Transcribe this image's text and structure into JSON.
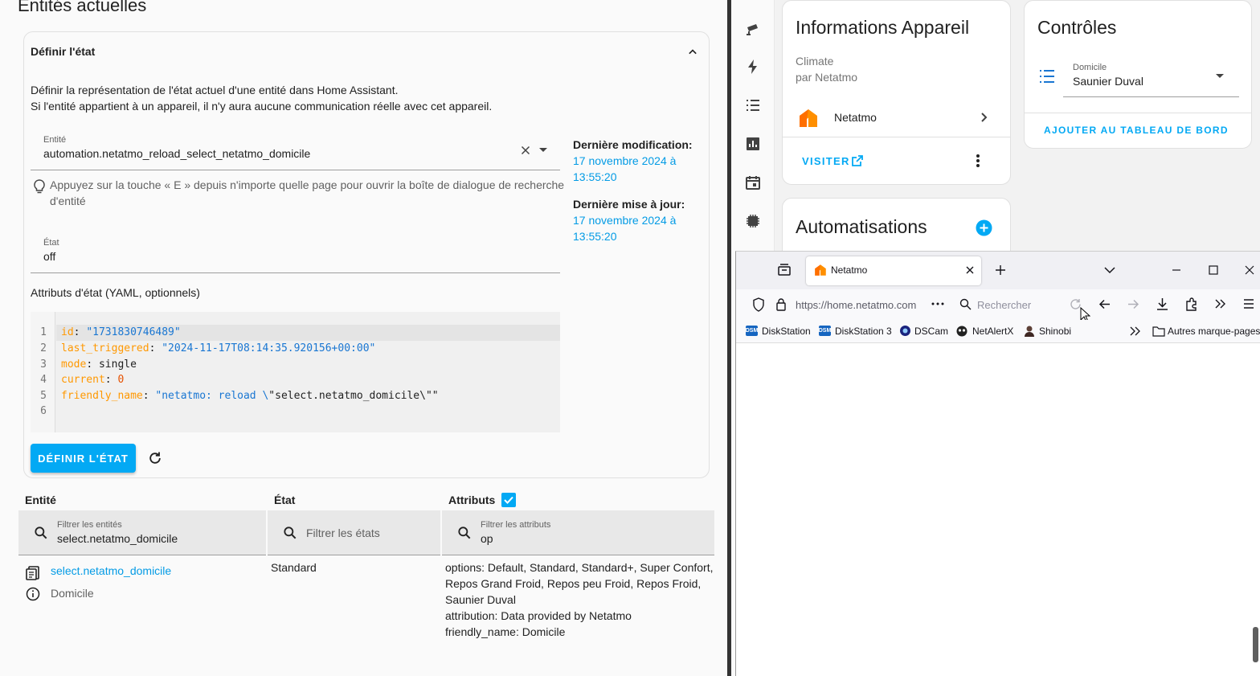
{
  "left": {
    "title": "Entités actuelles",
    "card": {
      "header": "Définir l'état",
      "description_line1": "Définir la représentation de l'état actuel d'une entité dans Home Assistant.",
      "description_line2": "Si l'entité appartient à un appareil, il n'y aura aucune communication réelle avec cet appareil.",
      "entity_label": "Entité",
      "entity_value": "automation.netatmo_reload_select_netatmo_domicile",
      "hint": "Appuyez sur la touche « E » depuis n'importe quelle page pour ouvrir la boîte de dialogue de recherche",
      "hint_line2": "d'entité",
      "state_label": "État",
      "state_value": "off",
      "last_changed_label": "Dernière modification:",
      "last_changed_l1": "17 novembre 2024 à",
      "last_changed_l2": "13:55:20",
      "last_updated_label": "Dernière mise à jour:",
      "last_updated_l1": "17 novembre 2024 à",
      "last_updated_l2": "13:55:20",
      "attributes_label": "Attributs d'état (YAML, optionnels)",
      "line_numbers": [
        "1",
        "2",
        "3",
        "4",
        "5",
        "6"
      ],
      "code": {
        "l1k": "id",
        "l1v": "\"1731830746489\"",
        "l2k": "last_triggered",
        "l2v": "\"2024-11-17T08:14:35.920156+00:00\"",
        "l3k": "mode",
        "l3v": "single",
        "l4k": "current",
        "l4v": "0",
        "l5k": "friendly_name",
        "l5v1": "\"netatmo: reload \\",
        "l5v2": "\"select.netatmo_domicile\\\"\""
      },
      "set_button": "DÉFINIR L'ÉTAT"
    },
    "table": {
      "col_entity": "Entité",
      "col_state": "État",
      "col_attributes": "Attributs",
      "filter_entity_label": "Filtrer les entités",
      "filter_entity_value": "select.netatmo_domicile",
      "filter_state_placeholder": "Filtrer les états",
      "filter_attr_label": "Filtrer les attributs",
      "filter_attr_value": "op",
      "row": {
        "entity_id": "select.netatmo_domicile",
        "entity_name": "Domicile",
        "state": "Standard",
        "attr_l1": "options: Default, Standard, Standard+, Super Confort,",
        "attr_l2": "Repos Grand Froid, Repos peu Froid, Repos Froid,",
        "attr_l3": "Saunier Duval",
        "attr_l4": "attribution: Data provided by Netatmo",
        "attr_l5": "friendly_name: Domicile"
      }
    }
  },
  "device": {
    "title": "Informations Appareil",
    "subtitle1": "Climate",
    "subtitle2": "par Netatmo",
    "integration": "Netatmo",
    "visit": "VISITER"
  },
  "controls": {
    "title": "Contrôles",
    "select_label": "Domicile",
    "select_value": "Saunier Duval",
    "add_button": "AJOUTER AU TABLEAU DE BORD"
  },
  "automations": {
    "title": "Automatisations"
  },
  "browser": {
    "tab_title": "Netatmo",
    "url": "https://home.netatmo.com",
    "search_placeholder": "Rechercher",
    "bookmarks": [
      "DiskStation",
      "DiskStation 3",
      "DSCam",
      "NetAlertX",
      "Shinobi"
    ],
    "other_bookmarks": "Autres marque-pages",
    "dsm_icon": "DSM"
  },
  "colors": {
    "accent": "#03a9f4",
    "netatmo_orange": "#ff8f00"
  }
}
